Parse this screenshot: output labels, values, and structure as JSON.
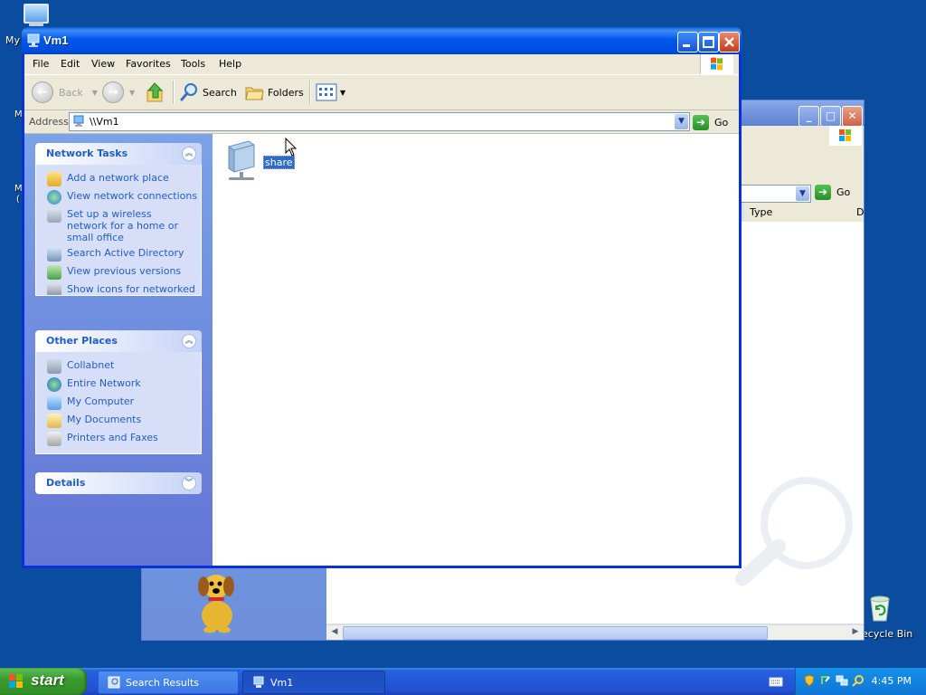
{
  "desktop": {
    "my_computer_label": "My",
    "cut_labels": [
      "M",
      "M",
      "("
    ],
    "recycle_bin_label": "ecycle Bin"
  },
  "background_window": {
    "go_label": "Go",
    "column_type": "Type",
    "column_cut": "D"
  },
  "window": {
    "title": "Vm1",
    "menu": [
      "File",
      "Edit",
      "View",
      "Favorites",
      "Tools",
      "Help"
    ],
    "toolbar": {
      "back_label": "Back",
      "search_label": "Search",
      "folders_label": "Folders"
    },
    "address": {
      "label": "Address",
      "value": "\\\\Vm1",
      "go_label": "Go"
    },
    "network_tasks": {
      "title": "Network Tasks",
      "items": [
        "Add a network place",
        "View network connections",
        "Set up a wireless network for a home or small office",
        "Search Active Directory",
        "View previous versions",
        "Show icons for networked"
      ]
    },
    "other_places": {
      "title": "Other Places",
      "items": [
        "Collabnet",
        "Entire Network",
        "My Computer",
        "My Documents",
        "Printers and Faxes"
      ]
    },
    "details": {
      "title": "Details"
    },
    "content": {
      "items": [
        {
          "name": "share",
          "icon": "network-share-icon"
        }
      ]
    }
  },
  "taskbar": {
    "start_label": "start",
    "tasks": [
      {
        "label": "Search Results",
        "active": false
      },
      {
        "label": "Vm1",
        "active": true
      }
    ],
    "clock": "4:45 PM"
  },
  "colors": {
    "desktop": "#0a4c9e",
    "task_link": "#215dc6",
    "selection": "#316ac5"
  }
}
